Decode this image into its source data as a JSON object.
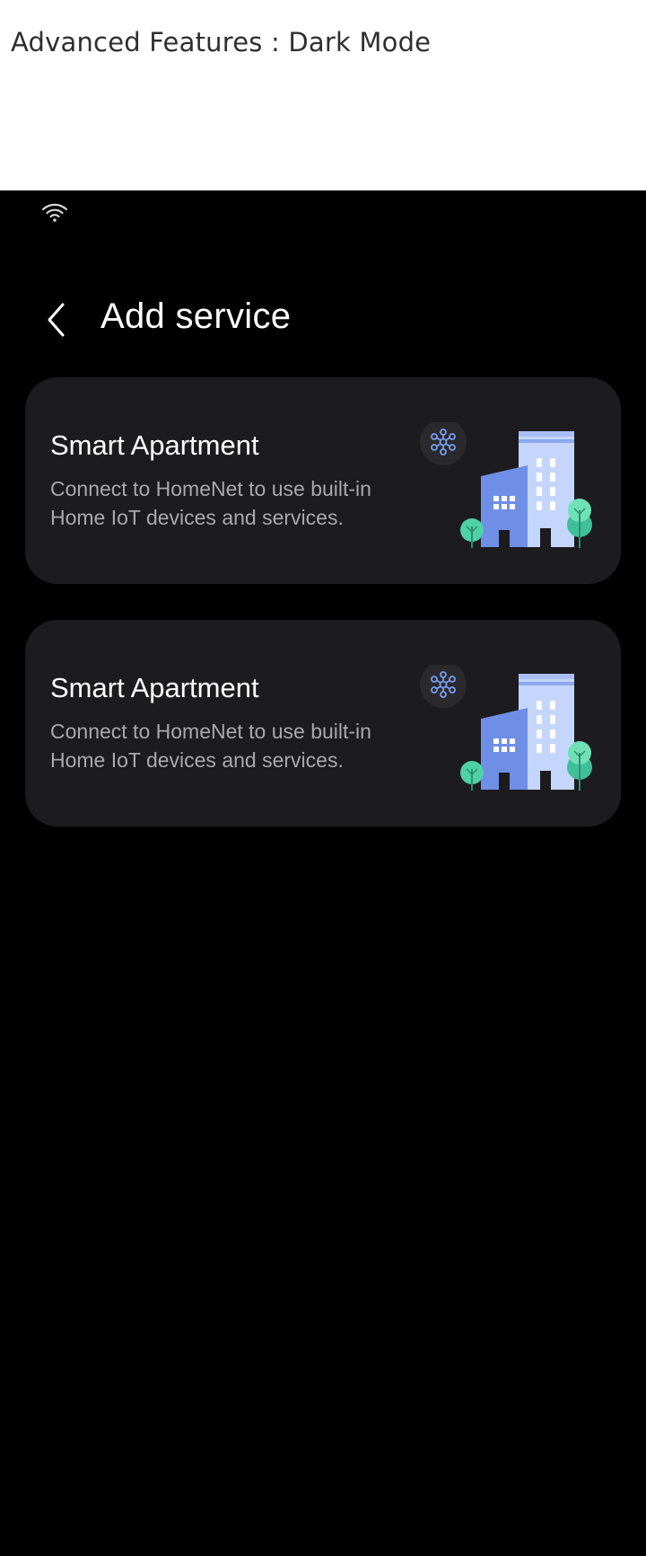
{
  "doc_header": {
    "title": "Advanced Features : Dark Mode"
  },
  "status_bar": {
    "icons": [
      "wifi-icon"
    ]
  },
  "header": {
    "back_icon": "chevron-left-icon",
    "title": "Add service"
  },
  "services": [
    {
      "title": "Smart Apartment",
      "description": "Connect to HomeNet to use built-in Home IoT devices and services.",
      "illustration": "apartment-building-illustration"
    },
    {
      "title": "Smart Apartment",
      "description": "Connect to HomeNet to use built-in Home IoT devices and services.",
      "illustration": "apartment-building-illustration"
    }
  ],
  "colors": {
    "background": "#000000",
    "card": "#1c1c1e",
    "title_text": "#ffffff",
    "secondary_text": "#a9a9ad",
    "building_light": "#c4d6fb",
    "building_dark": "#6f8ee6",
    "tree": "#4fd1a5"
  }
}
